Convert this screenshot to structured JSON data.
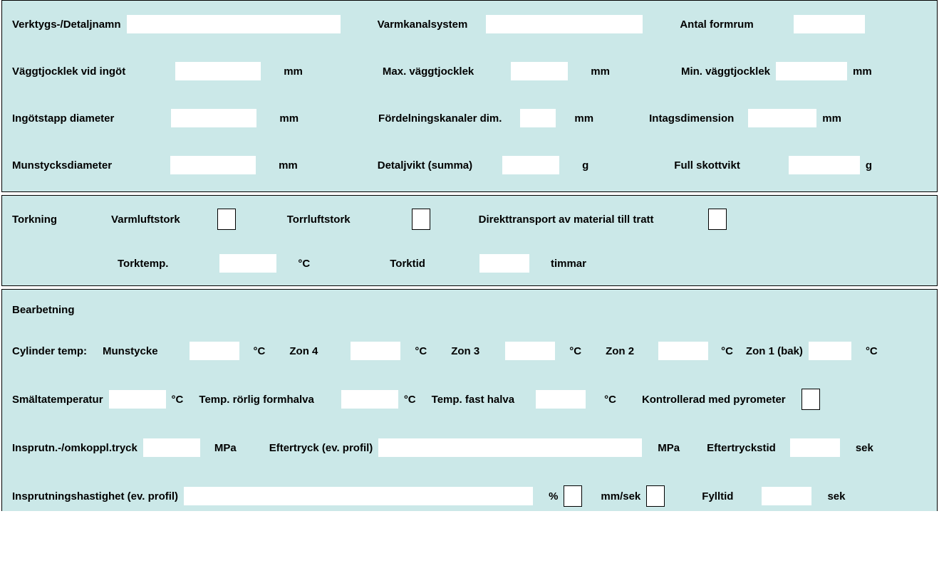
{
  "section1": {
    "tool_name_lbl": "Verktygs-/Detaljnamn",
    "hot_runner_lbl": "Varmkanalsystem",
    "cavities_lbl": "Antal formrum",
    "wall_at_gate_lbl": "Väggtjocklek vid ingöt",
    "max_wall_lbl": "Max. väggtjocklek",
    "min_wall_lbl": "Min. väggtjocklek",
    "sprue_dia_lbl": "Ingötstapp diameter",
    "runners_dim_lbl": "Fördelningskanaler dim.",
    "gate_dim_lbl": "Intagsdimension",
    "nozzle_dia_lbl": "Munstycksdiameter",
    "part_weight_lbl": "Detaljvikt (summa)",
    "shot_weight_lbl": "Full skottvikt",
    "unit_mm": "mm",
    "unit_g": "g"
  },
  "section2": {
    "drying_lbl": "Torkning",
    "hot_air_lbl": "Varmluftstork",
    "dry_air_lbl": "Torrluftstork",
    "direct_lbl": "Direkttransport av material till tratt",
    "dry_temp_lbl": "Torktemp.",
    "dry_time_lbl": "Torktid",
    "unit_c": "°C",
    "unit_h": "timmar"
  },
  "section3": {
    "processing_lbl": "Bearbetning",
    "cyl_temp_lbl": "Cylinder temp:",
    "nozzle_lbl": "Munstycke",
    "zone4_lbl": "Zon 4",
    "zone3_lbl": "Zon 3",
    "zone2_lbl": "Zon 2",
    "zone1_lbl": "Zon 1 (bak)",
    "melt_temp_lbl": "Smältatemperatur",
    "moving_half_lbl": "Temp. rörlig formhalva",
    "fixed_half_lbl": "Temp. fast halva",
    "pyrometer_lbl": "Kontrollerad med pyrometer",
    "inj_press_lbl": "Insprutn.-/omkoppl.tryck",
    "hold_press_lbl": "Eftertryck (ev. profil)",
    "hold_time_lbl": "Eftertryckstid",
    "inj_speed_lbl": "Insprutningshastighet (ev. profil)",
    "fill_time_lbl": "Fylltid",
    "unit_c": "°C",
    "unit_mpa": "MPa",
    "unit_sek": "sek",
    "unit_pct": "%",
    "unit_mmsek": "mm/sek"
  }
}
